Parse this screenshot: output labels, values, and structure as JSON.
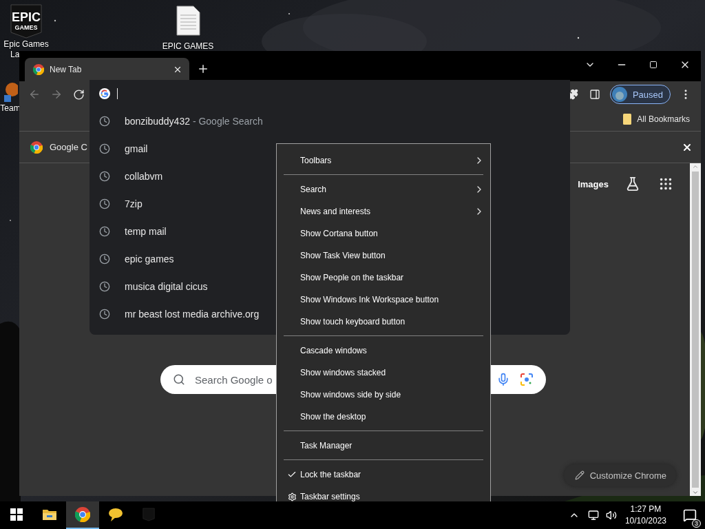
{
  "desktop": {
    "icons": [
      {
        "kind": "epic",
        "logo_lines": [
          "EPIC",
          "GAMES"
        ],
        "label_lines": [
          "Epic Games",
          "La"
        ]
      },
      {
        "kind": "document",
        "label_lines": [
          "EPIC GAMES"
        ]
      },
      {
        "kind": "team",
        "label_lines": [
          "Team"
        ]
      }
    ]
  },
  "browser": {
    "tabs": [
      {
        "title": "New Tab",
        "selected": true
      }
    ],
    "profile": {
      "label": "Paused"
    },
    "bookmarks": [
      {
        "label": "All Bookmarks"
      }
    ],
    "infobar": {
      "text": "Google C"
    },
    "omnibox": {
      "suggestions": [
        {
          "text": "bonzibuddy432",
          "detail": "- Google Search"
        },
        {
          "text": "gmail"
        },
        {
          "text": "collabvm"
        },
        {
          "text": "7zip"
        },
        {
          "text": "temp mail"
        },
        {
          "text": "epic games"
        },
        {
          "text": "musica digital cicus"
        },
        {
          "text": "mr beast lost media archive.org"
        }
      ]
    },
    "page": {
      "links": [
        "Images"
      ],
      "search_placeholder": "Search Google o",
      "customize": "Customize Chrome"
    }
  },
  "context_menu": {
    "sections": [
      [
        {
          "label": "Toolbars",
          "kind": "submenu",
          "checked": false
        }
      ],
      [
        {
          "label": "Search",
          "kind": "submenu",
          "checked": false
        },
        {
          "label": "News and interests",
          "kind": "submenu",
          "checked": false
        },
        {
          "label": "Show Cortana button",
          "kind": "toggle",
          "checked": false
        },
        {
          "label": "Show Task View button",
          "kind": "toggle",
          "checked": false
        },
        {
          "label": "Show People on the taskbar",
          "kind": "toggle",
          "checked": false
        },
        {
          "label": "Show Windows Ink Workspace button",
          "kind": "toggle",
          "checked": false
        },
        {
          "label": "Show touch keyboard button",
          "kind": "toggle",
          "checked": false
        }
      ],
      [
        {
          "label": "Cascade windows",
          "kind": "action",
          "checked": false
        },
        {
          "label": "Show windows stacked",
          "kind": "action",
          "checked": false
        },
        {
          "label": "Show windows side by side",
          "kind": "action",
          "checked": false
        },
        {
          "label": "Show the desktop",
          "kind": "action",
          "checked": false
        }
      ],
      [
        {
          "label": "Task Manager",
          "kind": "action",
          "checked": false
        }
      ],
      [
        {
          "label": "Lock the taskbar",
          "kind": "toggle",
          "checked": true
        },
        {
          "label": "Taskbar settings",
          "kind": "settings",
          "checked": false
        }
      ]
    ]
  },
  "taskbar": {
    "apps": [
      {
        "kind": "explorer",
        "selected": false
      },
      {
        "kind": "chrome",
        "selected": true
      },
      {
        "kind": "chat",
        "selected": false
      },
      {
        "kind": "epic",
        "selected": false
      }
    ],
    "time": "1:27 PM",
    "date": "10/10/2023",
    "notifications": "3"
  }
}
